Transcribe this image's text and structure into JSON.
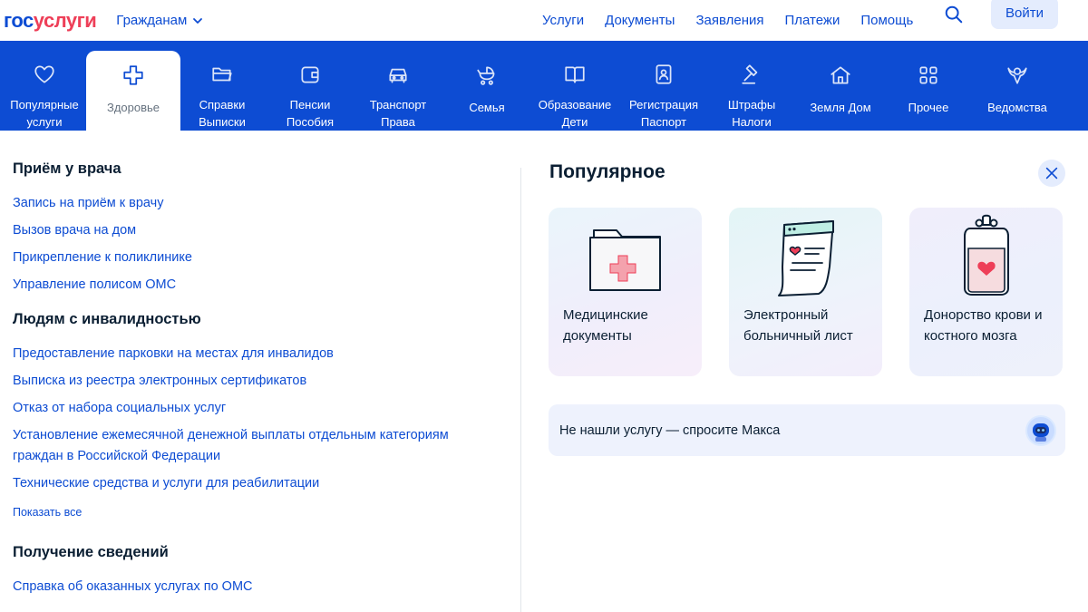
{
  "header": {
    "logo_part1": "гос",
    "logo_part2": "услуги",
    "audience": "Гражданам",
    "nav": [
      "Услуги",
      "Документы",
      "Заявления",
      "Платежи",
      "Помощь"
    ],
    "login": "Войти"
  },
  "categories": [
    {
      "label": "Популярные\nуслуги",
      "icon": "heart-icon"
    },
    {
      "label": "Здоровье",
      "icon": "medical-cross-icon",
      "active": true
    },
    {
      "label": "Справки\nВыписки",
      "icon": "folder-icon"
    },
    {
      "label": "Пенсии\nПособия",
      "icon": "wallet-icon"
    },
    {
      "label": "Транспорт\nПрава",
      "icon": "car-icon"
    },
    {
      "label": "Семья",
      "icon": "stroller-icon"
    },
    {
      "label": "Образование\nДети",
      "icon": "book-icon"
    },
    {
      "label": "Регистрация\nПаспорт",
      "icon": "id-card-icon"
    },
    {
      "label": "Штрафы\nНалоги",
      "icon": "gavel-icon"
    },
    {
      "label": "Земля Дом",
      "icon": "house-icon"
    },
    {
      "label": "Прочее",
      "icon": "grid-icon"
    },
    {
      "label": "Ведомства",
      "icon": "emblem-icon"
    }
  ],
  "sections": {
    "doctor": {
      "title": "Приём у врача",
      "links": [
        "Запись на приём к врачу",
        "Вызов врача на дом",
        "Прикрепление к поликлинике",
        "Управление полисом ОМС"
      ]
    },
    "disability": {
      "title": "Людям с инвалидностью",
      "links": [
        "Предоставление парковки на местах для инвалидов",
        "Выписка из реестра электронных сертификатов",
        "Отказ от набора социальных услуг",
        "Установление ежемесячной денежной выплаты отдельным категориям граждан в Российской Федерации",
        "Технические средства и услуги для реабилитации"
      ],
      "show_all": "Показать все"
    },
    "info": {
      "title": "Получение сведений",
      "links": [
        "Справка об оказанных услугах по ОМС"
      ]
    }
  },
  "popular": {
    "title": "Популярное",
    "cards": [
      {
        "text": "Медицинские документы",
        "icon": "medical-folder-icon"
      },
      {
        "text": "Электронный больничный лист",
        "icon": "sick-leave-document-icon"
      },
      {
        "text": "Донорство крови и костного мозга",
        "icon": "blood-bag-icon"
      }
    ],
    "ask": "Не нашли услугу — спросите Макса"
  },
  "colors": {
    "primary": "#0d4cd3",
    "accent": "#ee3f58",
    "text": "#0b1f33"
  }
}
